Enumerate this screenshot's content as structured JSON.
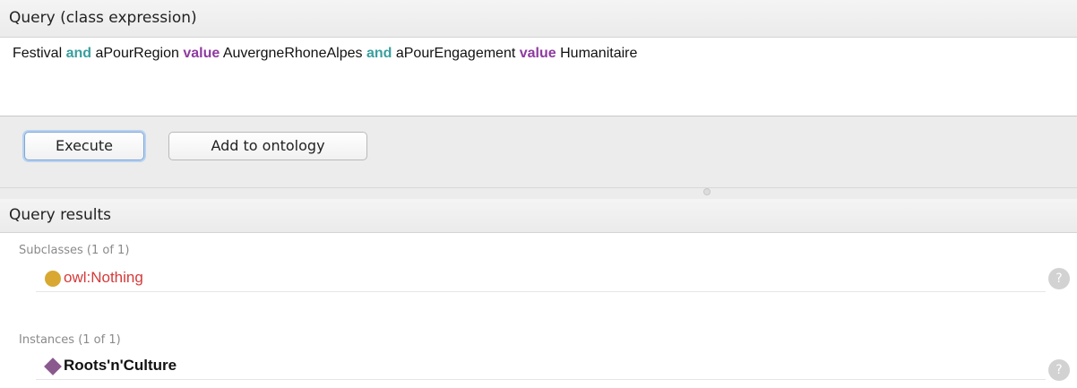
{
  "query": {
    "header": "Query (class expression)",
    "tokens": {
      "t1": "Festival",
      "t2": "and",
      "t3": "aPourRegion",
      "t4": "value",
      "t5": "AuvergneRhoneAlpes",
      "t6": "and",
      "t7": "aPourEngagement",
      "t8": "value",
      "t9": "Humanitaire"
    }
  },
  "buttons": {
    "execute": "Execute",
    "add_to_ontology": "Add to ontology"
  },
  "results": {
    "header": "Query results",
    "subclasses": {
      "label": "Subclasses (1 of 1)",
      "items": [
        "owl:Nothing"
      ]
    },
    "instances": {
      "label": "Instances (1 of 1)",
      "items": [
        "Roots'n'Culture"
      ]
    },
    "help_glyph": "?"
  },
  "colors": {
    "keyword_and": "#3a9e9e",
    "keyword_value": "#8e3aa1",
    "nothing_text": "#d63a3a",
    "class_icon": "#d8a832",
    "individual_icon": "#8a5a8e"
  },
  "icons": {
    "class": "class-circle-icon",
    "individual": "individual-diamond-icon",
    "help": "help-icon"
  }
}
